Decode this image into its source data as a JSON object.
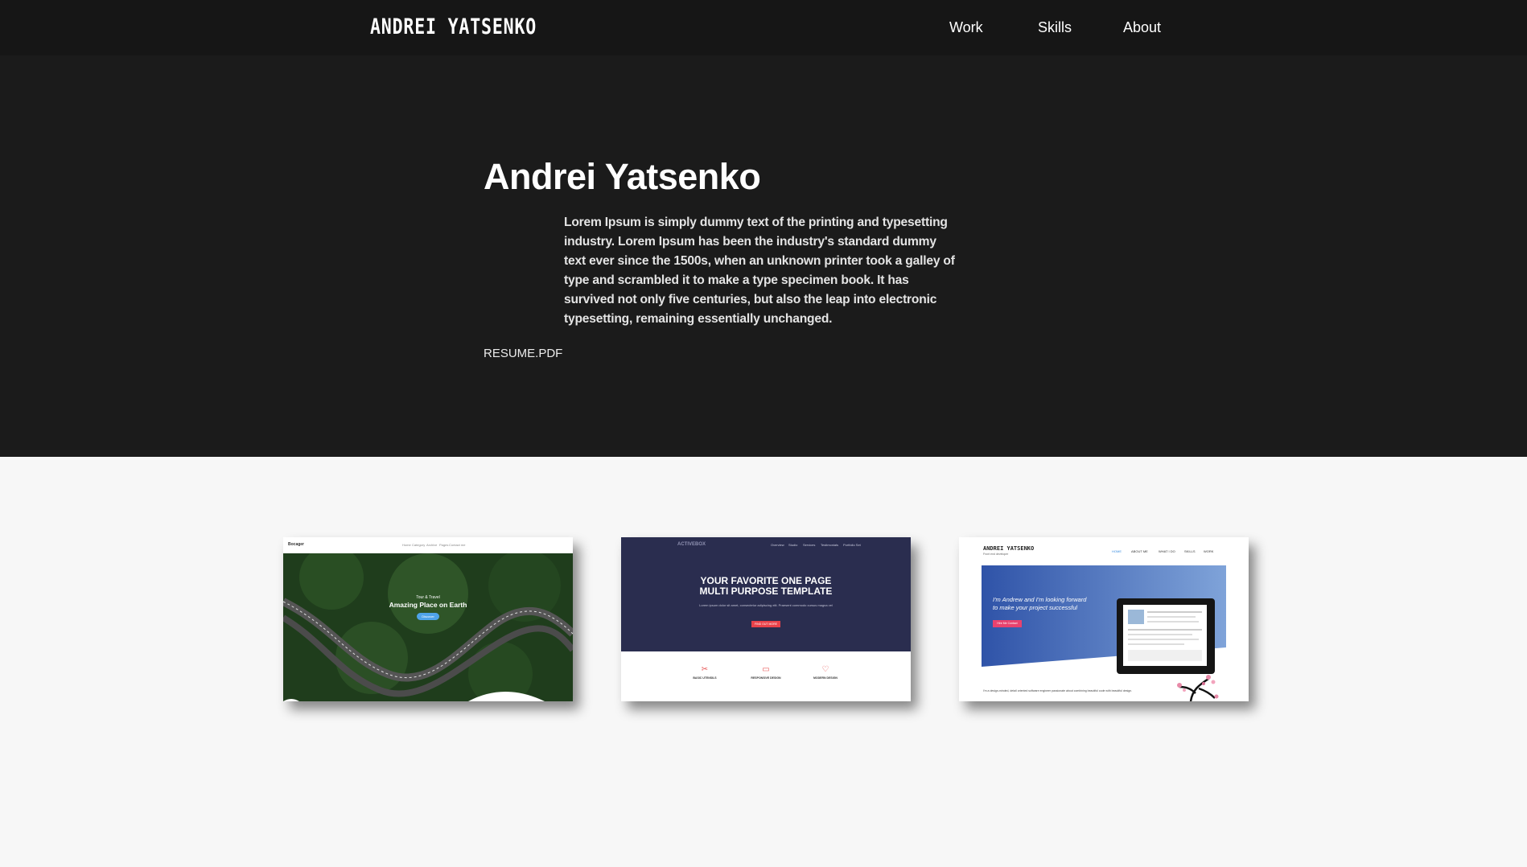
{
  "header": {
    "logo": "ANDREI YATSENKO",
    "nav": [
      {
        "label": "Work"
      },
      {
        "label": "Skills"
      },
      {
        "label": "About"
      }
    ]
  },
  "hero": {
    "name": "Andrei Yatsenko",
    "bio": "Lorem Ipsum is simply dummy text of the printing and typesetting industry. Lorem Ipsum has been the industry's standard dummy text ever since the 1500s, when an unknown printer took a galley of type and scrambled it to make a type specimen book. It has survived not only five centuries, but also the leap into electronic typesetting, remaining essentially unchanged.",
    "resume_link": "RESUME.PDF"
  },
  "projects": [
    {
      "name": "forest-road-template",
      "brand": "Bocager",
      "menu": [
        "Home",
        "Category",
        "Archive",
        "Pages",
        "Contact me"
      ],
      "kicker": "Tour & Travel",
      "headline": "Amazing Place on Earth",
      "button": "Discover"
    },
    {
      "name": "activebox-template",
      "brand": "ACTIVEBOX",
      "menu": [
        "Overview",
        "Studio",
        "Services",
        "Testimonials",
        "Portfolio Set"
      ],
      "title_line1": "YOUR FAVORITE ONE PAGE",
      "title_line2": "MULTI PURPOSE TEMPLATE",
      "subtitle": "Lorem ipsum dolor sit amet, consectetur adipiscing elit. Praesent commodo cursus magna vel",
      "cta": "FIND OUT MORE",
      "features": [
        {
          "icon": "✂",
          "label": "BASIC UTENSILS"
        },
        {
          "icon": "▭",
          "label": "RESPONSIVE DESIGN"
        },
        {
          "icon": "♡",
          "label": "MODERN DESIGN"
        }
      ]
    },
    {
      "name": "personal-portfolio-template",
      "logo": "ANDREI YATSENKO",
      "logo_sub": "Front end developer",
      "menu": [
        "HOME",
        "ABOUT ME",
        "WHAT I DO",
        "SKILLS",
        "WORK"
      ],
      "tagline_line1": "I'm Andrew and I'm looking forward",
      "tagline_line2": "to make your project successful",
      "button": "Hire Me Contact",
      "footer_text": "I'm a design-minded, detail oriented software engineer passionate about combining beautiful code with beautiful design."
    }
  ],
  "colors": {
    "header_bg": "#161616",
    "hero_bg": "#1b1b1b",
    "page_bg": "#f7f7f7",
    "accent_blue": "#3b8ee0",
    "accent_red": "#e8424a"
  }
}
